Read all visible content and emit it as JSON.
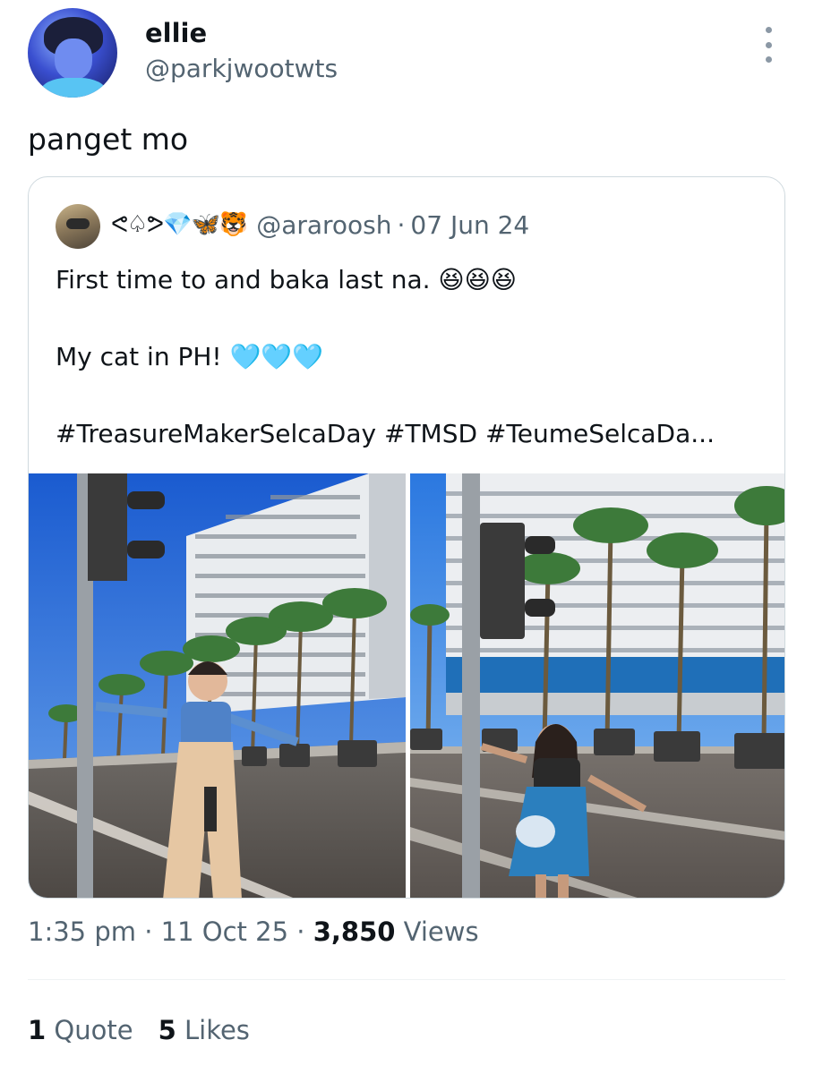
{
  "tweet": {
    "display_name": "ellie",
    "handle": "@parkjwootwts",
    "text": "panget mo",
    "timestamp_time": "1:35 pm",
    "timestamp_date": "11 Oct 25",
    "views_count": "3,850",
    "views_label": "Views",
    "quotes_count": "1",
    "quotes_label": "Quote",
    "likes_count": "5",
    "likes_label": "Likes"
  },
  "quoted_tweet": {
    "display_name": "ᕙ♤ᕗ💎🦋🐯",
    "handle": "@araroosh",
    "date": "07 Jun 24",
    "line1": "First time to and baka last na. 😆😆😆",
    "line2": "My cat in PH! 🩵🩵🩵",
    "line3": "#TreasureMakerSelcaDay #TMSD #TeumeSelcaDa..."
  },
  "separator": "·",
  "icons": {
    "more": "more-vertical-icon"
  },
  "colors": {
    "text_primary": "#0f1419",
    "text_secondary": "#536471",
    "border": "#cfd9de"
  }
}
